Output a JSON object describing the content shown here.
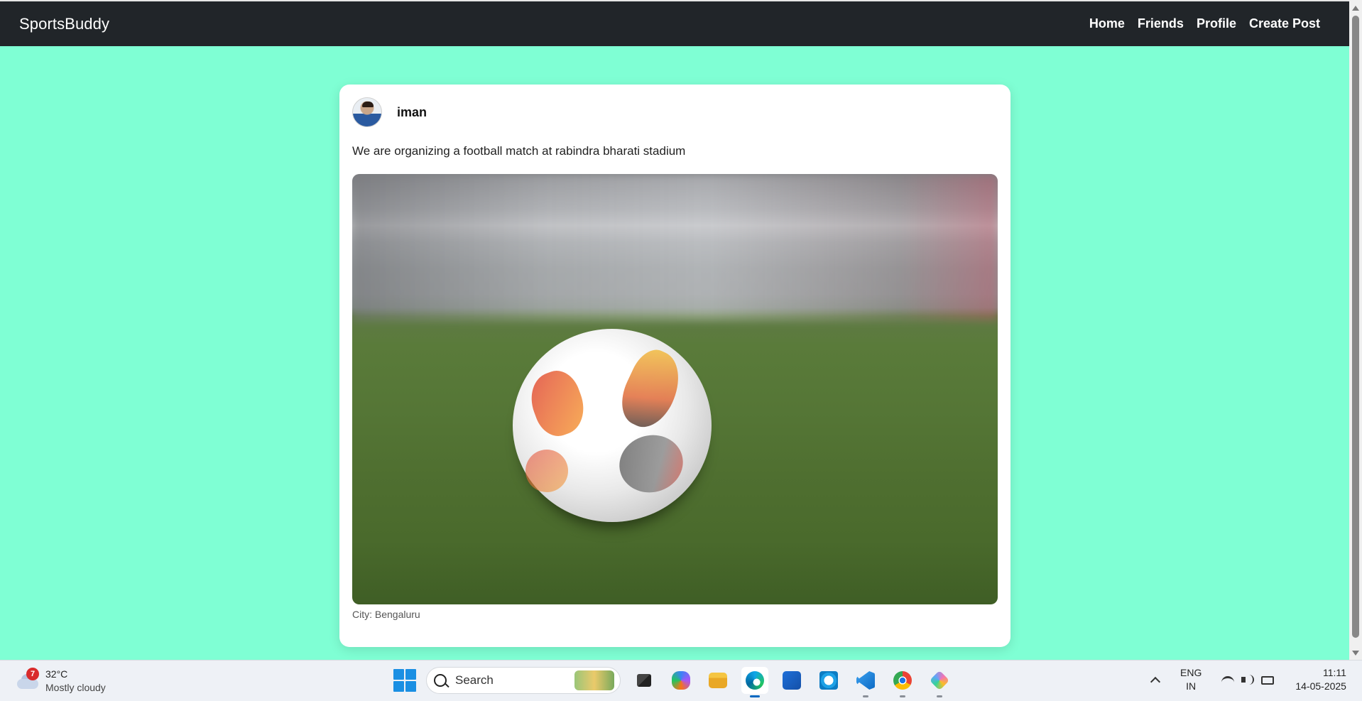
{
  "navbar": {
    "brand": "SportsBuddy",
    "links": [
      "Home",
      "Friends",
      "Profile",
      "Create Post"
    ]
  },
  "post": {
    "username": "iman",
    "text": "We are organizing a football match at rabindra bharati stadium",
    "city": "City: Bengaluru",
    "image_description_icon": "football-on-grass-image"
  },
  "taskbar": {
    "weather": {
      "badge": "7",
      "temperature": "32°C",
      "condition": "Mostly cloudy"
    },
    "search_label": "Search",
    "pinned_apps": [
      "file-explorer-icon",
      "copilot-icon",
      "folder-icon",
      "edge-icon",
      "store-icon",
      "alexa-icon",
      "vscode-icon",
      "chrome-icon",
      "app-icon"
    ],
    "language": {
      "line1": "ENG",
      "line2": "IN"
    },
    "clock": {
      "time": "11:11",
      "date": "14-05-2025"
    }
  },
  "colors": {
    "page_background": "#7fffd4",
    "navbar_background": "#212529",
    "accent": "#0067c0"
  }
}
